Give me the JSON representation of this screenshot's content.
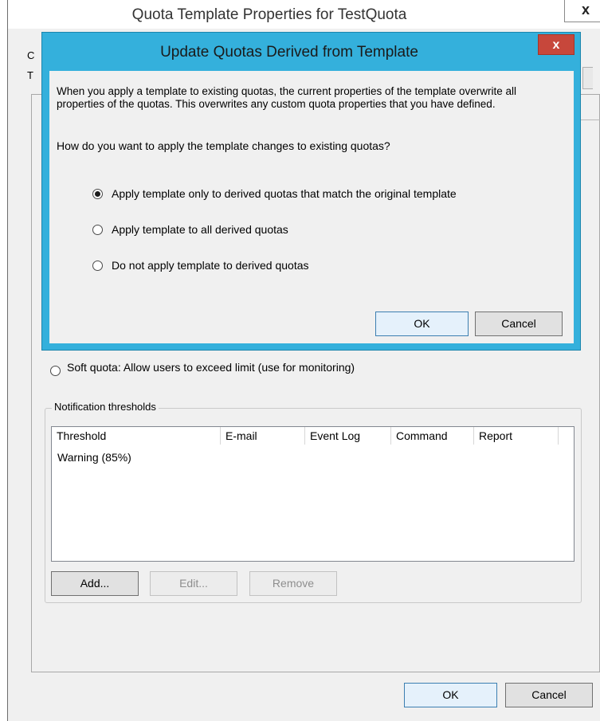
{
  "parent_window": {
    "title": "Quota Template Properties for TestQuota",
    "close_glyph": "x",
    "clipped_label_1": "C",
    "clipped_label_2": "T",
    "soft_quota_label": "Soft quota: Allow users to exceed limit (use for monitoring)",
    "soft_quota_selected": false,
    "notification": {
      "legend": "Notification thresholds",
      "columns": [
        "Threshold",
        "E-mail",
        "Event Log",
        "Command",
        "Report"
      ],
      "rows": [
        [
          "Warning (85%)",
          "",
          "",
          "",
          ""
        ]
      ]
    },
    "buttons": {
      "add": "Add...",
      "edit": "Edit...",
      "remove": "Remove",
      "ok": "OK",
      "cancel": "Cancel"
    }
  },
  "dialog": {
    "title": "Update Quotas Derived from Template",
    "close_glyph": "x",
    "intro": "When you apply a template to existing quotas, the current properties of the template overwrite all properties of the quotas. This overwrites any custom quota properties that you have defined.",
    "question": "How do you want to apply the template changes to existing quotas?",
    "options": [
      {
        "label": "Apply template only to derived quotas that match the original template",
        "selected": true
      },
      {
        "label": "Apply template to all derived quotas",
        "selected": false
      },
      {
        "label": "Do not apply template to derived quotas",
        "selected": false
      }
    ],
    "ok": "OK",
    "cancel": "Cancel"
  },
  "colors": {
    "dialog_frame": "#34b0dc",
    "dialog_close": "#c7473b",
    "window_bg": "#f0f0f0"
  }
}
